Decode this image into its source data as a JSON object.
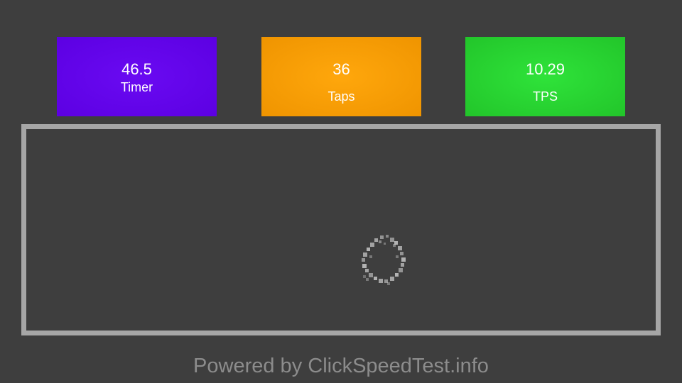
{
  "stats": {
    "timer": {
      "value": "46.5",
      "label": "Timer",
      "color": "#5c00e2"
    },
    "taps": {
      "value": "36",
      "label": "Taps",
      "color": "#ef9400"
    },
    "tps": {
      "value": "10.29",
      "label": "TPS",
      "color": "#22c52a"
    }
  },
  "tap_area": {
    "border_color": "#a6a6a6",
    "effect_icon": "tap-ripple-icon"
  },
  "footer": {
    "text": "Powered by ClickSpeedTest.info"
  }
}
